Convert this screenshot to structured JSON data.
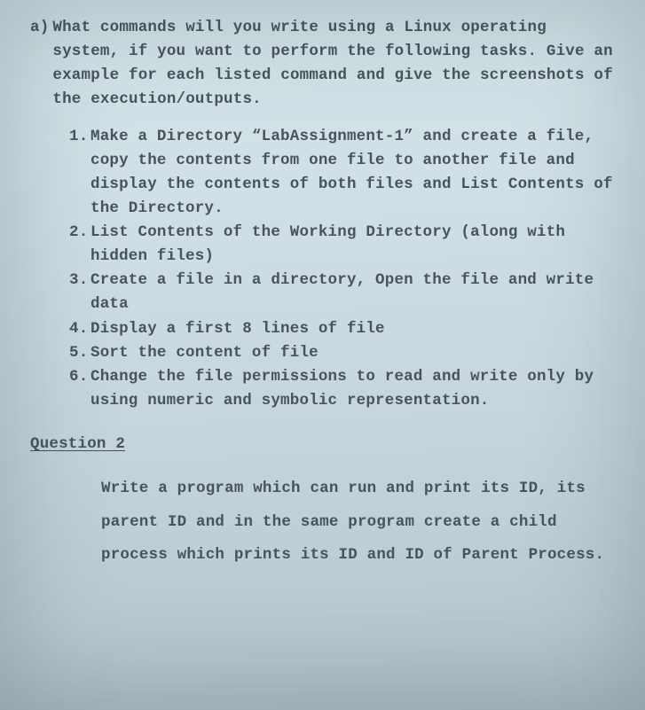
{
  "partA": {
    "marker": "a)",
    "intro": "What commands will you write using a Linux operating system, if you want to perform the following tasks. Give an example for each listed command and give the screenshots of the execution/outputs.",
    "items": [
      {
        "num": "1.",
        "text": "Make a Directory “LabAssignment-1” and create a file, copy the contents from one file to another file and display the contents of both files and List Contents of the Directory."
      },
      {
        "num": "2.",
        "text": "List Contents of the Working Directory (along with hidden files)"
      },
      {
        "num": "3.",
        "text": "Create a file in a directory, Open the file and write data"
      },
      {
        "num": "4.",
        "text": "Display a first 8 lines of file"
      },
      {
        "num": "5.",
        "text": "Sort the content of file"
      },
      {
        "num": "6.",
        "text": "Change the file permissions to read and write only by using numeric and symbolic representation."
      }
    ]
  },
  "question2": {
    "heading": "Question 2",
    "body": "Write a program which can run and print its ID, its parent ID and in the same program create a child process which prints its ID and ID of Parent Process."
  }
}
